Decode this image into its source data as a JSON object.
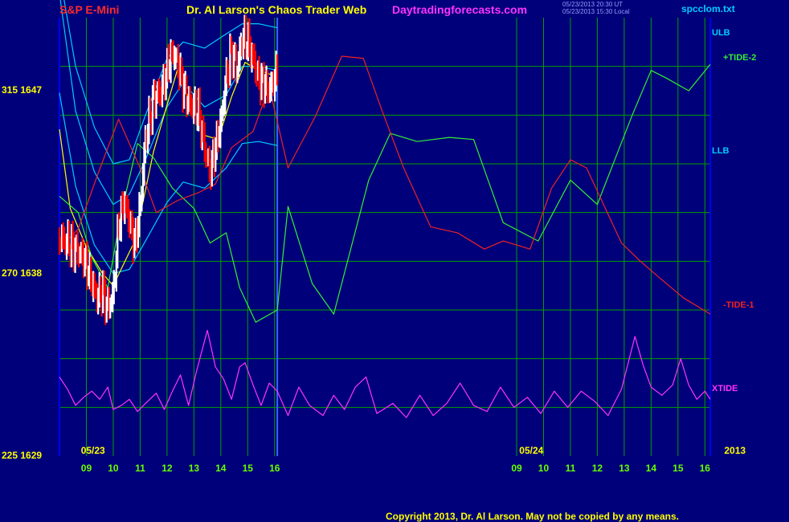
{
  "header": {
    "left_title": "S&P E-Mini",
    "center_title": "Dr. Al Larson's Chaos Trader Web",
    "site": "Daytradingforecasts.com",
    "stamp_line1": "05/23/2013 20:30 UT",
    "stamp_line2": "05/23/2013 15:30 Local",
    "file": "spcclom.txt"
  },
  "colors": {
    "background": "#00007a",
    "grid": "#00a000",
    "price_up": "#ffffff",
    "price_down": "#ff0000",
    "ma": "#ffff00",
    "bands": "#00ccff",
    "tide2": "#33ee33",
    "tide1": "#ee2222",
    "xtide": "#ff33ff"
  },
  "chart_data": {
    "type": "line",
    "title": "S&P E-Mini",
    "y_labels": [
      {
        "text": "315  1647",
        "price": 1647
      },
      {
        "text": "270  1638",
        "price": 1638
      },
      {
        "text": "225  1629",
        "price": 1629
      }
    ],
    "ylim": [
      1629,
      1650.6
    ],
    "date_labels": [
      {
        "text": "05/23",
        "hour": 8.2
      },
      {
        "text": "05/24",
        "hour": 24.5
      },
      {
        "text": "2013",
        "hour": 32.6
      }
    ],
    "x_ticks": [
      {
        "text": "09",
        "hour": 9
      },
      {
        "text": "10",
        "hour": 10
      },
      {
        "text": "11",
        "hour": 11
      },
      {
        "text": "12",
        "hour": 12
      },
      {
        "text": "13",
        "hour": 13
      },
      {
        "text": "14",
        "hour": 14
      },
      {
        "text": "15",
        "hour": 15
      },
      {
        "text": "16",
        "hour": 16
      },
      {
        "text": "09",
        "hour": 25
      },
      {
        "text": "10",
        "hour": 26
      },
      {
        "text": "11",
        "hour": 27
      },
      {
        "text": "12",
        "hour": 28
      },
      {
        "text": "13",
        "hour": 29
      },
      {
        "text": "14",
        "hour": 30
      },
      {
        "text": "15",
        "hour": 31
      },
      {
        "text": "16",
        "hour": 32
      }
    ],
    "xlim": [
      8.0,
      32.2
    ],
    "day_separator_hour": 16.1,
    "grid": true,
    "price_bars_hourly": [
      [
        8.0,
        1639.8
      ],
      [
        8.3,
        1639.5
      ],
      [
        8.6,
        1639.2
      ],
      [
        8.9,
        1638.8
      ],
      [
        9.2,
        1637.6
      ],
      [
        9.4,
        1636.8
      ],
      [
        9.6,
        1637.2
      ],
      [
        9.8,
        1636.3
      ],
      [
        10.0,
        1636.9
      ],
      [
        10.2,
        1640.4
      ],
      [
        10.4,
        1641.6
      ],
      [
        10.6,
        1640.6
      ],
      [
        10.8,
        1639.4
      ],
      [
        11.0,
        1641.2
      ],
      [
        11.2,
        1644.6
      ],
      [
        11.5,
        1646.6
      ],
      [
        11.8,
        1647.0
      ],
      [
        12.0,
        1648.0
      ],
      [
        12.2,
        1648.9
      ],
      [
        12.4,
        1648.4
      ],
      [
        12.6,
        1647.2
      ],
      [
        12.8,
        1646.4
      ],
      [
        13.0,
        1646.2
      ],
      [
        13.2,
        1645.8
      ],
      [
        13.4,
        1644.2
      ],
      [
        13.6,
        1643.0
      ],
      [
        13.8,
        1644.2
      ],
      [
        14.0,
        1645.4
      ],
      [
        14.2,
        1647.6
      ],
      [
        14.4,
        1649.0
      ],
      [
        14.6,
        1648.0
      ],
      [
        14.8,
        1649.6
      ],
      [
        15.0,
        1649.4
      ],
      [
        15.2,
        1648.6
      ],
      [
        15.4,
        1647.6
      ],
      [
        15.6,
        1647.4
      ],
      [
        15.8,
        1647.0
      ],
      [
        16.0,
        1647.6
      ],
      [
        16.1,
        1647.8
      ]
    ],
    "series": [
      {
        "name": "ULB",
        "points": [
          [
            8.0,
            1652.8
          ],
          [
            8.6,
            1648.2
          ],
          [
            9.3,
            1645.2
          ],
          [
            10.0,
            1643.4
          ],
          [
            10.6,
            1643.6
          ],
          [
            11.2,
            1645.8
          ],
          [
            12.0,
            1648.6
          ],
          [
            12.6,
            1649.4
          ],
          [
            13.4,
            1649.1
          ],
          [
            14.2,
            1649.8
          ],
          [
            14.8,
            1650.3
          ],
          [
            15.4,
            1650.3
          ],
          [
            16.1,
            1650.1
          ]
        ]
      },
      {
        "name": "",
        "points": [
          [
            8.0,
            1651.8
          ],
          [
            8.6,
            1646.0
          ],
          [
            9.3,
            1643.0
          ],
          [
            10.0,
            1641.4
          ],
          [
            10.6,
            1641.9
          ],
          [
            11.2,
            1643.6
          ],
          [
            12.0,
            1646.2
          ],
          [
            12.6,
            1647.4
          ],
          [
            13.4,
            1646.2
          ],
          [
            14.2,
            1646.8
          ],
          [
            14.8,
            1648.2
          ],
          [
            15.4,
            1648.2
          ],
          [
            16.1,
            1648.0
          ]
        ]
      },
      {
        "name": "LLB",
        "points": [
          [
            8.0,
            1646.9
          ],
          [
            8.6,
            1642.3
          ],
          [
            9.3,
            1639.4
          ],
          [
            10.0,
            1638.0
          ],
          [
            10.6,
            1638.2
          ],
          [
            11.2,
            1639.6
          ],
          [
            12.0,
            1641.5
          ],
          [
            12.6,
            1642.5
          ],
          [
            13.4,
            1642.2
          ],
          [
            14.2,
            1643.2
          ],
          [
            14.8,
            1644.4
          ],
          [
            15.4,
            1644.5
          ],
          [
            16.1,
            1644.3
          ]
        ]
      },
      {
        "name": "",
        "points": [
          [
            8.0,
            1645.1
          ],
          [
            8.4,
            1641.2
          ],
          [
            9.0,
            1639.3
          ],
          [
            9.6,
            1638.0
          ],
          [
            10.0,
            1637.4
          ],
          [
            10.8,
            1639.6
          ],
          [
            11.5,
            1644.0
          ],
          [
            12.0,
            1646.3
          ],
          [
            12.4,
            1648.1
          ],
          [
            12.9,
            1646.3
          ],
          [
            13.4,
            1644.8
          ],
          [
            13.9,
            1644.6
          ],
          [
            14.4,
            1646.7
          ],
          [
            14.9,
            1648.4
          ],
          [
            15.4,
            1648.0
          ],
          [
            16.1,
            1647.7
          ]
        ]
      },
      {
        "name": "+TIDE-2",
        "points": [
          [
            8.0,
            1641.8
          ],
          [
            8.7,
            1641.0
          ],
          [
            9.2,
            1638.8
          ],
          [
            9.8,
            1637.3
          ],
          [
            10.3,
            1641.0
          ],
          [
            10.9,
            1644.4
          ],
          [
            11.5,
            1643.7
          ],
          [
            12.2,
            1642.2
          ],
          [
            13.0,
            1641.2
          ],
          [
            13.6,
            1639.5
          ],
          [
            14.2,
            1640.0
          ],
          [
            14.7,
            1637.3
          ],
          [
            15.3,
            1635.6
          ],
          [
            16.1,
            1636.2
          ],
          [
            16.5,
            1641.3
          ],
          [
            17.4,
            1637.5
          ],
          [
            18.2,
            1636.0
          ],
          [
            19.5,
            1642.6
          ],
          [
            20.3,
            1644.9
          ],
          [
            21.3,
            1644.5
          ],
          [
            22.5,
            1644.7
          ],
          [
            23.4,
            1644.6
          ],
          [
            24.5,
            1640.5
          ],
          [
            25.8,
            1639.6
          ],
          [
            27.0,
            1642.6
          ],
          [
            28.0,
            1641.4
          ],
          [
            29.3,
            1645.8
          ],
          [
            30.0,
            1648.0
          ],
          [
            30.6,
            1647.6
          ],
          [
            31.4,
            1647.0
          ],
          [
            32.2,
            1648.3
          ]
        ]
      },
      {
        "name": "-TIDE-1",
        "points": [
          [
            8.0,
            1639.2
          ],
          [
            8.7,
            1640.2
          ],
          [
            9.4,
            1642.8
          ],
          [
            10.2,
            1645.6
          ],
          [
            11.0,
            1643.2
          ],
          [
            11.6,
            1641.0
          ],
          [
            12.4,
            1641.6
          ],
          [
            13.2,
            1642.0
          ],
          [
            13.8,
            1642.4
          ],
          [
            14.4,
            1644.2
          ],
          [
            15.2,
            1645.0
          ],
          [
            15.8,
            1647.2
          ],
          [
            16.5,
            1643.2
          ],
          [
            17.5,
            1645.7
          ],
          [
            18.5,
            1648.7
          ],
          [
            19.3,
            1648.6
          ],
          [
            20.0,
            1646.0
          ],
          [
            20.8,
            1643.2
          ],
          [
            21.8,
            1640.3
          ],
          [
            22.8,
            1640.0
          ],
          [
            23.8,
            1639.2
          ],
          [
            24.5,
            1639.6
          ],
          [
            25.0,
            1639.4
          ],
          [
            25.5,
            1639.2
          ],
          [
            26.3,
            1642.2
          ],
          [
            27.0,
            1643.6
          ],
          [
            27.6,
            1643.2
          ],
          [
            28.3,
            1641.2
          ],
          [
            28.9,
            1639.5
          ],
          [
            29.6,
            1638.6
          ],
          [
            30.3,
            1637.8
          ],
          [
            31.2,
            1636.8
          ],
          [
            32.2,
            1636.0
          ]
        ]
      },
      {
        "name": "XTIDE",
        "points": [
          [
            8.0,
            1632.9
          ],
          [
            8.3,
            1632.3
          ],
          [
            8.6,
            1631.5
          ],
          [
            8.9,
            1631.9
          ],
          [
            9.2,
            1632.2
          ],
          [
            9.5,
            1631.8
          ],
          [
            9.8,
            1632.4
          ],
          [
            10.0,
            1631.3
          ],
          [
            10.3,
            1631.5
          ],
          [
            10.6,
            1631.8
          ],
          [
            10.9,
            1631.2
          ],
          [
            11.2,
            1631.6
          ],
          [
            11.6,
            1632.1
          ],
          [
            11.9,
            1631.3
          ],
          [
            12.2,
            1632.2
          ],
          [
            12.5,
            1633.0
          ],
          [
            12.8,
            1631.5
          ],
          [
            13.1,
            1633.2
          ],
          [
            13.5,
            1635.2
          ],
          [
            13.8,
            1633.4
          ],
          [
            14.1,
            1632.8
          ],
          [
            14.4,
            1631.8
          ],
          [
            14.7,
            1633.4
          ],
          [
            14.9,
            1633.6
          ],
          [
            15.2,
            1632.5
          ],
          [
            15.5,
            1631.5
          ],
          [
            15.8,
            1632.6
          ],
          [
            16.1,
            1632.2
          ],
          [
            16.5,
            1631.0
          ],
          [
            16.9,
            1632.4
          ],
          [
            17.3,
            1631.5
          ],
          [
            17.8,
            1631.0
          ],
          [
            18.2,
            1632.0
          ],
          [
            18.6,
            1631.3
          ],
          [
            19.0,
            1632.4
          ],
          [
            19.4,
            1632.9
          ],
          [
            19.8,
            1631.1
          ],
          [
            20.4,
            1631.6
          ],
          [
            20.9,
            1630.9
          ],
          [
            21.4,
            1632.0
          ],
          [
            21.9,
            1631.0
          ],
          [
            22.4,
            1631.6
          ],
          [
            22.9,
            1632.6
          ],
          [
            23.4,
            1631.5
          ],
          [
            23.9,
            1631.2
          ],
          [
            24.4,
            1632.4
          ],
          [
            24.9,
            1631.4
          ],
          [
            25.4,
            1631.9
          ],
          [
            25.9,
            1631.1
          ],
          [
            26.4,
            1632.2
          ],
          [
            26.9,
            1631.4
          ],
          [
            27.4,
            1632.2
          ],
          [
            27.9,
            1631.7
          ],
          [
            28.4,
            1631.0
          ],
          [
            28.9,
            1632.3
          ],
          [
            29.4,
            1634.9
          ],
          [
            29.7,
            1633.5
          ],
          [
            30.0,
            1632.4
          ],
          [
            30.4,
            1632.0
          ],
          [
            30.8,
            1632.5
          ],
          [
            31.1,
            1633.8
          ],
          [
            31.4,
            1632.5
          ],
          [
            31.7,
            1631.8
          ],
          [
            32.0,
            1632.2
          ],
          [
            32.2,
            1631.8
          ]
        ]
      }
    ],
    "right_labels": [
      {
        "text": "ULB",
        "color": "#00ccff",
        "price": 1649.8
      },
      {
        "text": "+TIDE-2",
        "color": "#33ee33",
        "price": 1648.6
      },
      {
        "text": "LLB",
        "color": "#00ccff",
        "price": 1644.0
      },
      {
        "text": "-TIDE-1",
        "color": "#ee2222",
        "price": 1636.4
      },
      {
        "text": "XTIDE",
        "color": "#ff33ff",
        "price": 1632.3
      }
    ]
  },
  "footer": {
    "copyright": "Copyright 2013, Dr. Al Larson. May not be copied by any means."
  }
}
